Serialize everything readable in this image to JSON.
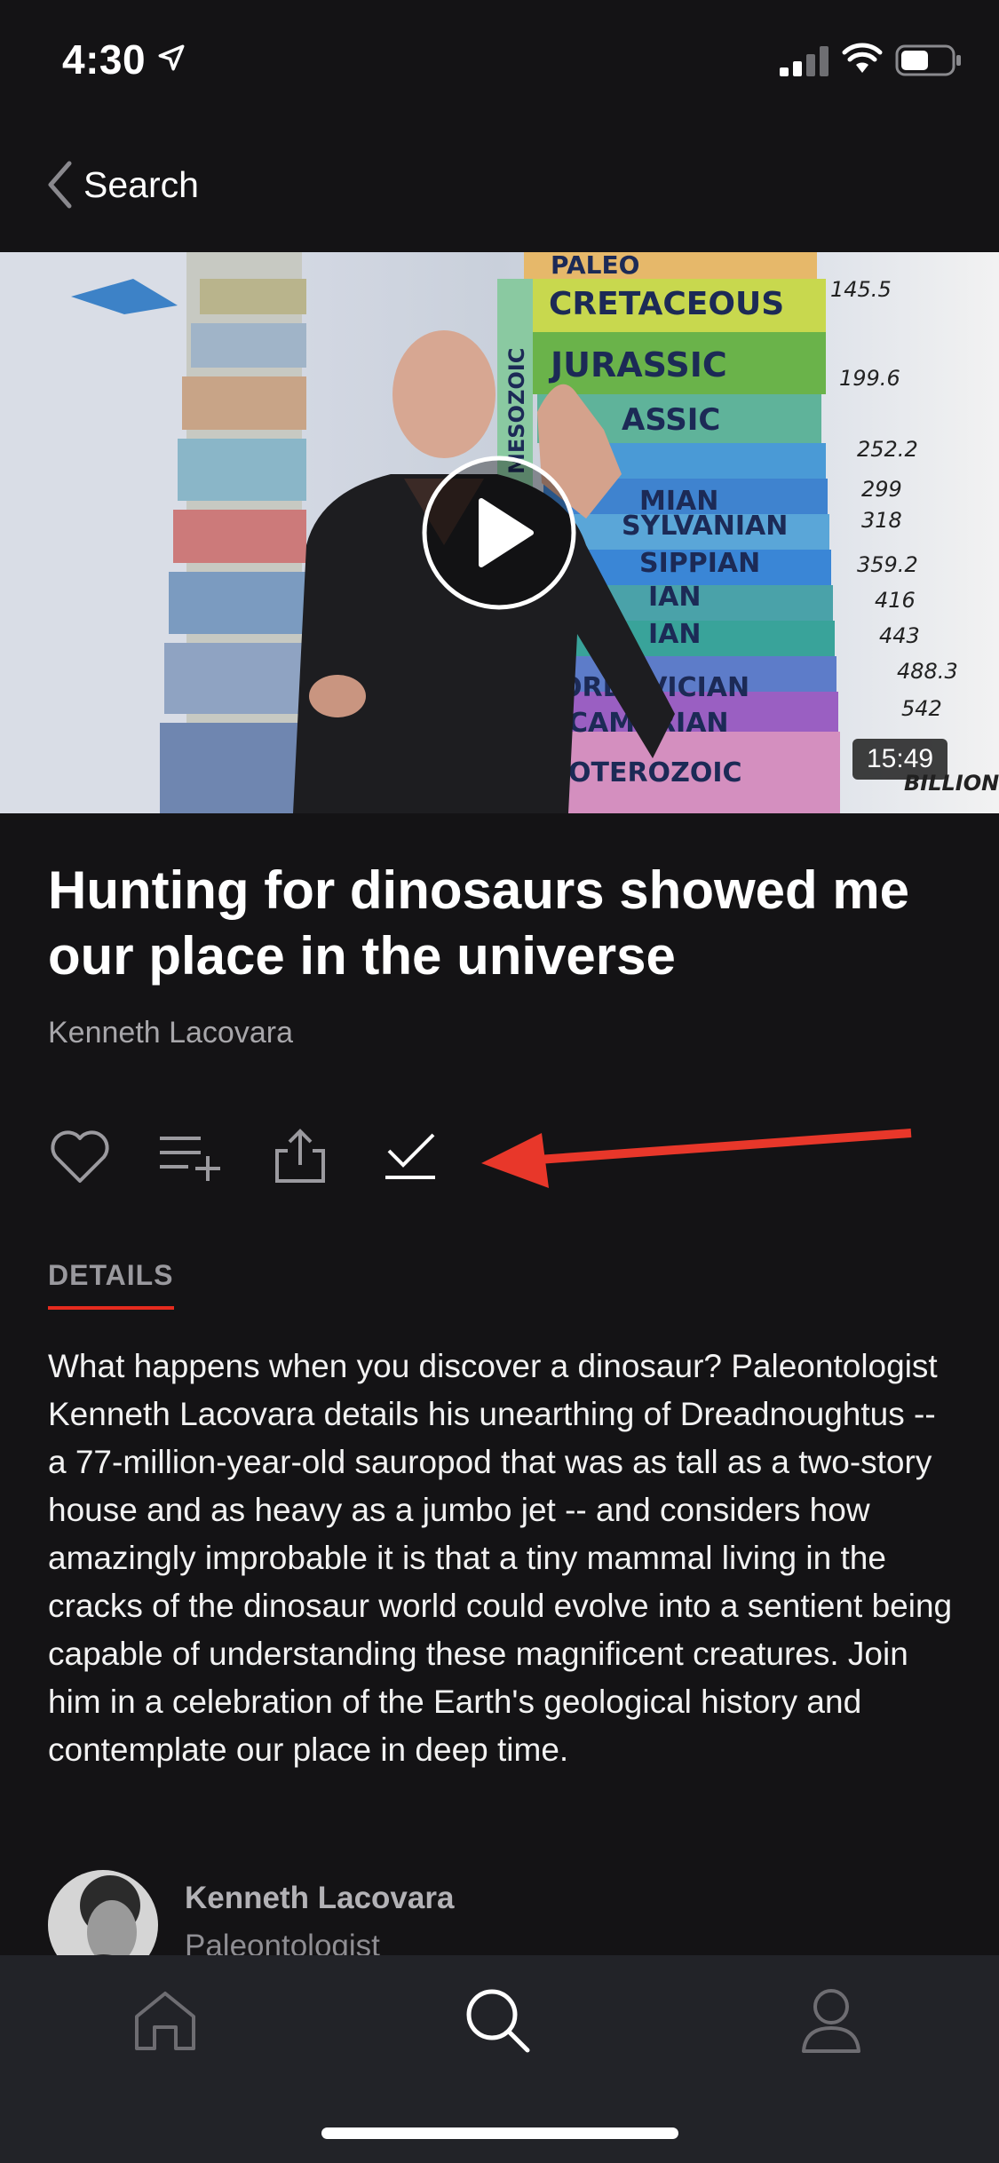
{
  "status_bar": {
    "time": "4:30",
    "icons": [
      "location-arrow-icon",
      "cellular-signal-icon",
      "wifi-icon",
      "battery-icon"
    ]
  },
  "nav": {
    "back_label": "Search",
    "back_icon": "chevron-left-icon"
  },
  "video": {
    "duration": "15:49",
    "play_icon": "play-icon",
    "chart_labels": [
      "PALEO",
      "CRETACEOUS",
      "JURASSIC",
      "TRIASSIC",
      "PERMIAN",
      "PENNSYLVANIAN",
      "MISSISSIPPIAN",
      "DEVONIAN",
      "SILURIAN",
      "ORDOVICIAN",
      "CAMBRIAN",
      "PROTEROZOIC",
      "MESOZOIC"
    ],
    "chart_numbers": [
      "145.5",
      "199.6",
      "252.2",
      "299",
      "318",
      "359.2",
      "416",
      "443",
      "488.3",
      "542"
    ],
    "chart_unit": "BILLION"
  },
  "talk": {
    "title": "Hunting for dinosaurs showed me our place in the universe",
    "speaker": "Kenneth Lacovara"
  },
  "actions": [
    {
      "name": "favorite",
      "icon": "heart-icon"
    },
    {
      "name": "add-to-list",
      "icon": "playlist-add-icon"
    },
    {
      "name": "share",
      "icon": "share-icon"
    },
    {
      "name": "mark-watched",
      "icon": "checkmark-icon"
    }
  ],
  "annotation": {
    "arrow_color": "#e8372a"
  },
  "details": {
    "tab_label": "DETAILS",
    "description": "What happens when you discover a dinosaur? Paleontologist Kenneth Lacovara details his unearthing of Dreadnoughtus -- a 77-million-year-old sauropod that was as tall as a two-story house and as heavy as a jumbo jet -- and considers how amazingly improbable it is that a tiny mammal living in the cracks of the dinosaur world could evolve into a sentient being capable of understanding these magnificent creatures. Join him in a celebration of the Earth's geological history and contemplate our place in deep time."
  },
  "speaker_card": {
    "name": "Kenneth Lacovara",
    "role": "Paleontologist"
  },
  "tab_bar": [
    {
      "name": "home",
      "icon": "home-icon"
    },
    {
      "name": "search",
      "icon": "search-icon"
    },
    {
      "name": "profile",
      "icon": "profile-icon"
    }
  ],
  "colors": {
    "background": "#141315",
    "accent": "#e62b1e",
    "tab_bar": "#222328"
  }
}
